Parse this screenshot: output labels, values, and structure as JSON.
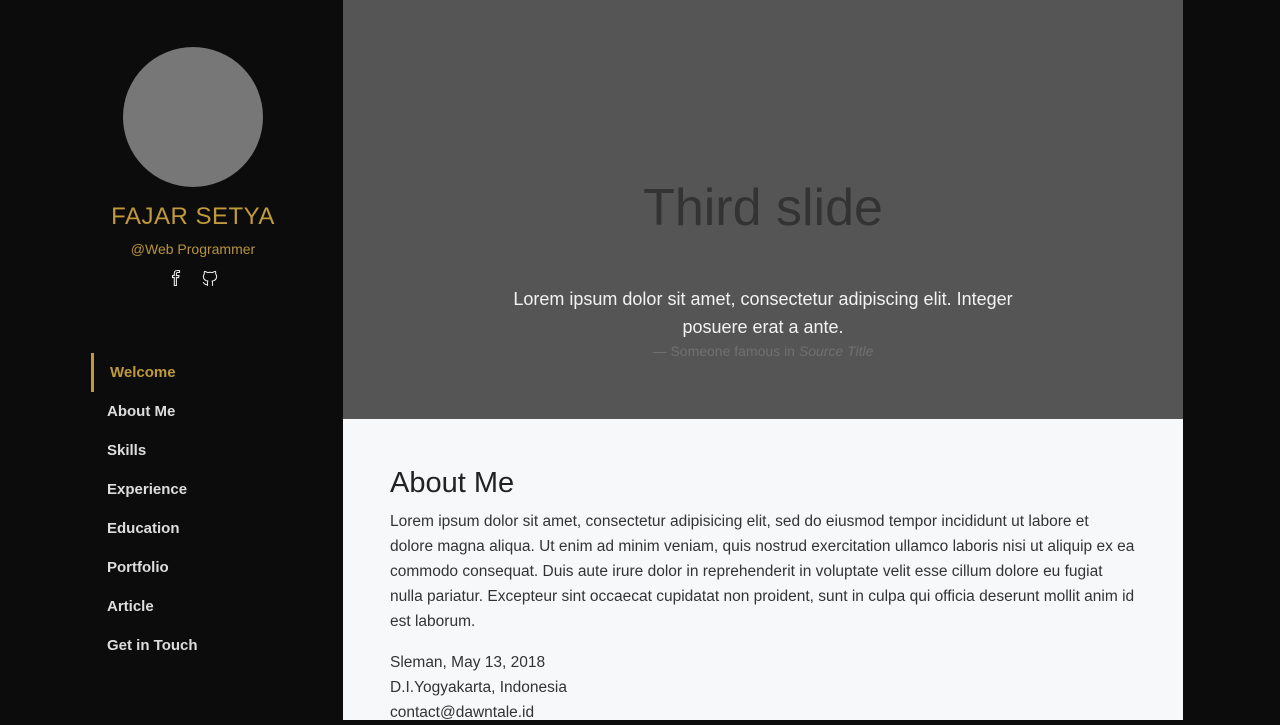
{
  "profile": {
    "name": "FAJAR SETYA",
    "role": "@Web Programmer",
    "social_icons": [
      "facebook-icon",
      "github-icon"
    ]
  },
  "nav": {
    "items": [
      {
        "label": "Welcome",
        "active": true
      },
      {
        "label": "About Me"
      },
      {
        "label": "Skills"
      },
      {
        "label": "Experience"
      },
      {
        "label": "Education"
      },
      {
        "label": "Portfolio"
      },
      {
        "label": "Article"
      },
      {
        "label": "Get in Touch"
      }
    ]
  },
  "hero": {
    "title": "Third slide",
    "quote": "Lorem ipsum dolor sit amet, consectetur adipiscing elit. Integer posuere erat a ante.",
    "cite_prefix": "— Someone famous in ",
    "cite_source": "Source Title"
  },
  "about": {
    "title": "About Me",
    "paragraph": "Lorem ipsum dolor sit amet, consectetur adipisicing elit, sed do eiusmod tempor incididunt ut labore et dolore magna aliqua. Ut enim ad minim veniam, quis nostrud exercitation ullamco laboris nisi ut aliquip ex ea commodo consequat. Duis aute irure dolor in reprehenderit in voluptate velit esse cillum dolore eu fugiat nulla pariatur. Excepteur sint occaecat cupidatat non proident, sunt in culpa qui officia deserunt mollit anim id est laborum.",
    "date_line": "Sleman, May 13, 2018",
    "location": "D.I.Yogyakarta, Indonesia",
    "email": "contact@dawntale.id"
  },
  "colors": {
    "accent": "#c09a3a",
    "sidebar_bg": "#0c0c0c",
    "hero_bg": "#555555",
    "content_bg": "#f7f8fa"
  }
}
